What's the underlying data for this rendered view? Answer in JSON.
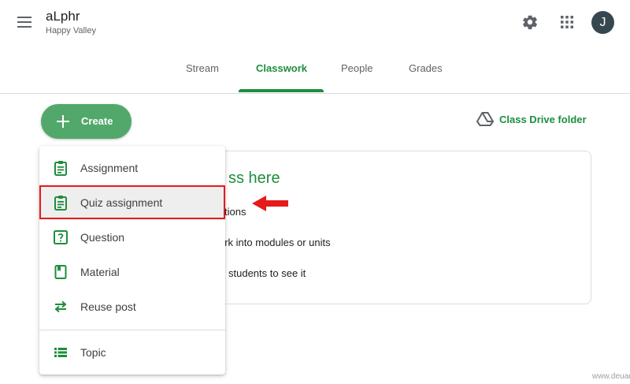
{
  "app": {
    "class_name": "aLphr",
    "section": "Happy Valley",
    "avatar_initial": "J"
  },
  "tabs": [
    {
      "label": "Stream",
      "active": false
    },
    {
      "label": "Classwork",
      "active": true
    },
    {
      "label": "People",
      "active": false
    },
    {
      "label": "Grades",
      "active": false
    }
  ],
  "toolbar": {
    "create_label": "Create",
    "drive_label": "Class Drive folder"
  },
  "card": {
    "heading": "ss here",
    "line1": "tions",
    "line2": "ork into modules or units",
    "line3": "students to see it"
  },
  "create_menu": {
    "items": [
      {
        "label": "Assignment",
        "icon": "assignment-icon"
      },
      {
        "label": "Quiz assignment",
        "icon": "quiz-icon"
      },
      {
        "label": "Question",
        "icon": "question-icon"
      },
      {
        "label": "Material",
        "icon": "material-icon"
      },
      {
        "label": "Reuse post",
        "icon": "reuse-icon"
      },
      {
        "label": "Topic",
        "icon": "topic-icon"
      }
    ],
    "highlighted": "Quiz assignment"
  },
  "colors": {
    "accent": "#1e8e3e",
    "create_button": "#52a86a",
    "annotation": "#e51b1b"
  },
  "watermark": "www.deuaq.com"
}
